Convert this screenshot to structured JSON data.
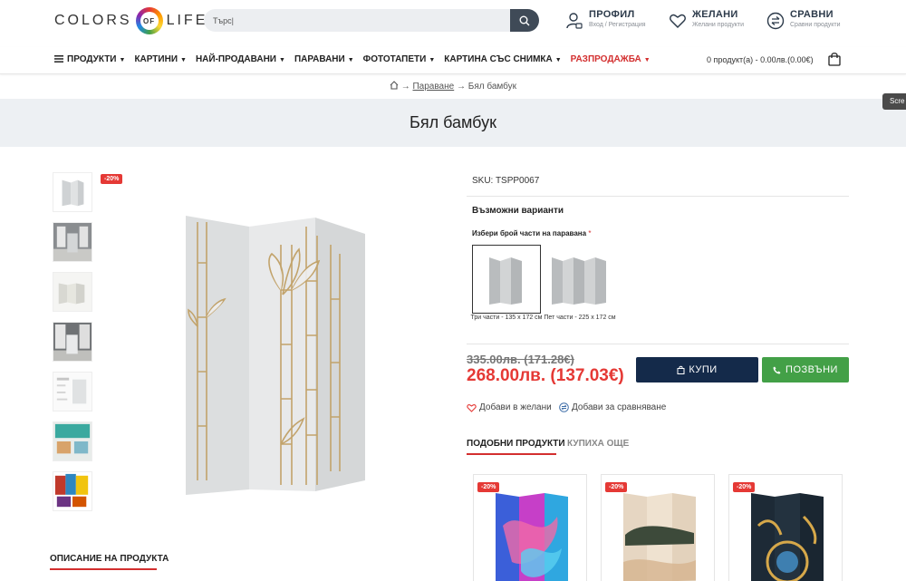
{
  "header": {
    "logo_left": "COLORS",
    "logo_mid": "OF",
    "logo_right": "LIFE",
    "search_placeholder": "Търс|",
    "profile_title": "ПРОФИЛ",
    "profile_sub": "Вход / Регистрация",
    "wishlist_title": "ЖЕЛАНИ",
    "wishlist_sub": "Желани продукти",
    "compare_title": "СРАВНИ",
    "compare_sub": "Сравни продукти"
  },
  "nav": {
    "items": [
      "ПРОДУКТИ",
      "КАРТИНИ",
      "НАЙ-ПРОДАВАНИ",
      "ПАРАВАНИ",
      "ФОТОТАПЕТИ",
      "КАРТИНА СЪС СНИМКА",
      "РАЗПРОДАЖБА"
    ],
    "cart_text": "0 продукт(а) - 0.00лв.(0.00€)"
  },
  "breadcrumb": {
    "arrow1": "→",
    "parent": "Параване",
    "arrow2": "→",
    "current": "Бял бамбук"
  },
  "page_title": "Бял бамбук",
  "tooltip": "Scre",
  "gallery": {
    "badge": "-20%"
  },
  "product": {
    "sku": "SKU: TSPP0067",
    "variants_title": "Възможни варианти",
    "variant_label": "Избери брой части на паравана",
    "required_mark": "*",
    "option1": "Три части - 135 x 172 см",
    "option2": "Пет части - 225 x 172 см",
    "old_price": "335.00лв. (171.28€)",
    "new_price": "268.00лв. (137.03€)",
    "buy_label": "КУПИ",
    "call_label": "ПОЗВЪНИ",
    "wishlist_label": "Добави в желани",
    "compare_label": "Добави за сравняване"
  },
  "tabs": {
    "similar": "ПОДОБНИ ПРОДУКТИ",
    "bought": "КУПИХА ОЩЕ",
    "description": "ОПИСАНИЕ НА ПРОДУКТА"
  },
  "cards": [
    {
      "badge": "-20%"
    },
    {
      "badge": "-20%"
    },
    {
      "badge": "-20%"
    }
  ],
  "colors": {
    "accent": "#e53935",
    "buy": "#142a4a",
    "call": "#43a047"
  }
}
